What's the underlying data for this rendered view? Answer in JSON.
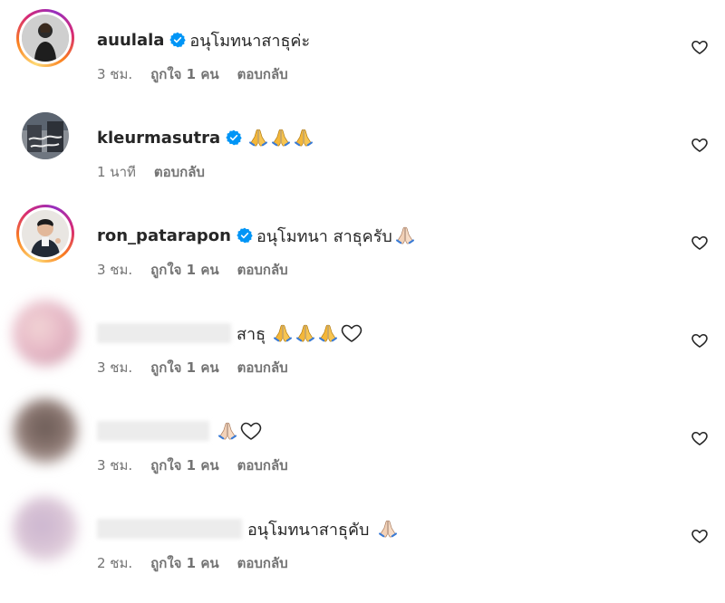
{
  "comments": [
    {
      "username": "auulala",
      "text": "อนุโมทนาสาธุค่ะ",
      "time": "3 ชม.",
      "likes": "ถูกใจ 1 คน",
      "reply": "ตอบกลับ",
      "verified": true
    },
    {
      "username": "kleurmasutra",
      "text": "",
      "emoji": [
        "folded-hands",
        "folded-hands",
        "folded-hands"
      ],
      "time": "1 นาที",
      "likes": "",
      "reply": "ตอบกลับ",
      "verified": true
    },
    {
      "username": "ron_patarapon",
      "text": "อนุโมทนา สาธุครับ",
      "emoji": [
        "folded-hands-light"
      ],
      "time": "3 ชม.",
      "likes": "ถูกใจ 1 คน",
      "reply": "ตอบกลับ",
      "verified": true
    },
    {
      "username": "",
      "text": "สาธุ",
      "emoji": [
        "folded-hands",
        "folded-hands",
        "folded-hands",
        "white-heart"
      ],
      "time": "3 ชม.",
      "likes": "ถูกใจ 1 คน",
      "reply": "ตอบกลับ",
      "verified": false
    },
    {
      "username": "",
      "text": "",
      "emoji": [
        "folded-hands-light",
        "white-heart"
      ],
      "time": "3 ชม.",
      "likes": "ถูกใจ 1 คน",
      "reply": "ตอบกลับ",
      "verified": false
    },
    {
      "username": "",
      "text": "อนุโมทนาสาธุคับ",
      "emoji": [
        "folded-hands-light"
      ],
      "time": "2 ชม.",
      "likes": "ถูกใจ 1 คน",
      "reply": "ตอบกลับ",
      "verified": false
    }
  ],
  "colors": {
    "verified_blue": "#0095f6",
    "muted_text": "#737373",
    "primary_text": "#262626",
    "story_ring": "#d62976"
  },
  "icons": {
    "like": "heart-outline-icon",
    "verified": "verified-badge-icon"
  }
}
